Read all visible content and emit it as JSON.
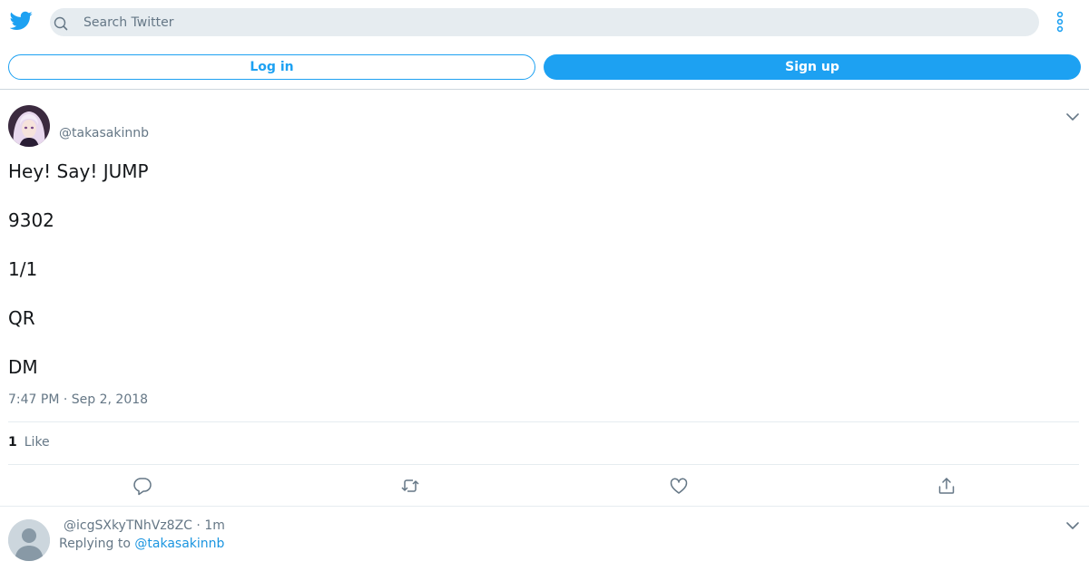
{
  "header": {
    "logo_icon": "twitter-bird-icon",
    "search": {
      "placeholder": "Search Twitter",
      "value": ""
    },
    "more_icon": "more-vertical-icon"
  },
  "auth": {
    "login_label": "Log in",
    "signup_label": "Sign up"
  },
  "tweet": {
    "handle": "@takasakinnb",
    "lines": [
      "Hey! Say! JUMP",
      "9302",
      "1/1",
      "QR",
      "DM"
    ],
    "timestamp": "7:47 PM · Sep 2, 2018",
    "likes": {
      "count": "1",
      "label": "Like"
    },
    "actions": [
      "reply-icon",
      "retweet-icon",
      "like-icon",
      "share-icon"
    ]
  },
  "reply": {
    "handle": "@icgSXkyTNhVz8ZC",
    "age": "1m",
    "replying_prefix": "Replying to",
    "replying_to": "@takasakinnb"
  },
  "colors": {
    "brand": "#1da1f2",
    "link": "#1b95e0",
    "muted": "#657786",
    "search_bg": "#e6ecf0"
  }
}
